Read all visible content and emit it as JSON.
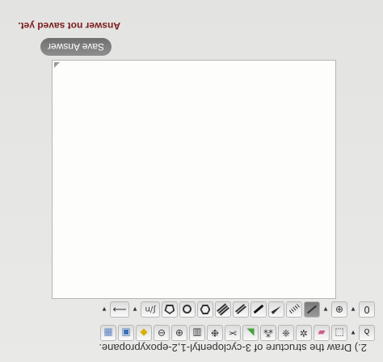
{
  "question": {
    "text": "2.) Draw the structure of 3-cyclopentyl-1,2-epoxypropane."
  },
  "toolbar_top": {
    "zero_label": "0",
    "plus_label": "⊕",
    "chain_label": "ʃ/n",
    "arrow_label": "⟶"
  },
  "save": {
    "button_label": "Save Answer",
    "status_text": "Answer not saved yet."
  },
  "colors": {
    "status_text": "#7a1c1c",
    "button_bg": "#7e7e7e"
  }
}
